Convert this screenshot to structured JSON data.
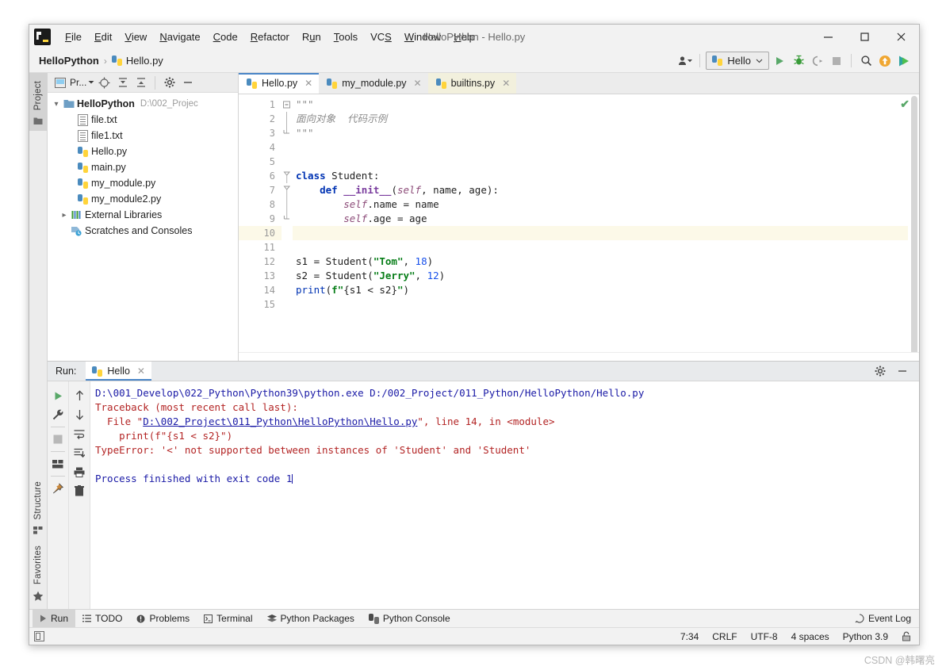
{
  "window": {
    "title": "HelloPython - Hello.py",
    "app_icon": "pycharm-logo-icon",
    "minimize": "—",
    "maximize": "□",
    "close": "✕"
  },
  "menu": {
    "items": [
      {
        "label": "File",
        "mnemonic": "F"
      },
      {
        "label": "Edit",
        "mnemonic": "E"
      },
      {
        "label": "View",
        "mnemonic": "V"
      },
      {
        "label": "Navigate",
        "mnemonic": "N"
      },
      {
        "label": "Code",
        "mnemonic": "C"
      },
      {
        "label": "Refactor",
        "mnemonic": "R"
      },
      {
        "label": "Run",
        "mnemonic": "u"
      },
      {
        "label": "Tools",
        "mnemonic": "T"
      },
      {
        "label": "VCS",
        "mnemonic": "S"
      },
      {
        "label": "Window",
        "mnemonic": "W"
      },
      {
        "label": "Help",
        "mnemonic": "H"
      }
    ]
  },
  "navbar": {
    "project_name": "HelloPython",
    "separator": "›",
    "file_name": "Hello.py",
    "run_config": "Hello",
    "buttons": [
      "user-icon",
      "run-button",
      "debug-button",
      "coverage-button",
      "stop-button",
      "search-everywhere-icon",
      "update-project-icon",
      "ide-assistant-icon"
    ]
  },
  "left_rail": {
    "top_label": "Project",
    "bottom_labels": [
      "Structure",
      "Favorites"
    ]
  },
  "project_panel": {
    "toolbar_label": "Pr...",
    "toolbar_icons": [
      "project-view-icon",
      "locate-icon",
      "expand-all-icon",
      "collapse-all-icon",
      "settings-icon",
      "hide-icon"
    ],
    "tree": [
      {
        "label": "HelloPython",
        "path": "D:\\002_Projec",
        "icon": "folder-icon",
        "arrow": "v",
        "indent": 0,
        "bold": true
      },
      {
        "label": "file.txt",
        "icon": "text-file-icon",
        "arrow": "",
        "indent": 1,
        "bold": false
      },
      {
        "label": "file1.txt",
        "icon": "text-file-icon",
        "arrow": "",
        "indent": 1,
        "bold": false
      },
      {
        "label": "Hello.py",
        "icon": "python-file-icon",
        "arrow": "",
        "indent": 1,
        "bold": false
      },
      {
        "label": "main.py",
        "icon": "python-file-icon",
        "arrow": "",
        "indent": 1,
        "bold": false
      },
      {
        "label": "my_module.py",
        "icon": "python-file-icon",
        "arrow": "",
        "indent": 1,
        "bold": false
      },
      {
        "label": "my_module2.py",
        "icon": "python-file-icon",
        "arrow": "",
        "indent": 1,
        "bold": false
      },
      {
        "label": "External Libraries",
        "icon": "libraries-icon",
        "arrow": ">",
        "indent": 0,
        "bold": false
      },
      {
        "label": "Scratches and Consoles",
        "icon": "scratches-icon",
        "arrow": "",
        "indent": 0,
        "bold": false
      }
    ]
  },
  "editor": {
    "tabs": [
      {
        "label": "Hello.py",
        "icon": "python-file-icon",
        "state": "active"
      },
      {
        "label": "my_module.py",
        "icon": "python-file-icon",
        "state": "normal"
      },
      {
        "label": "builtins.py",
        "icon": "python-file-icon",
        "state": "highlight"
      }
    ],
    "inspection_status": "ok-check-icon",
    "current_line": 10,
    "line_numbers": [
      1,
      2,
      3,
      4,
      5,
      6,
      7,
      8,
      9,
      10,
      11,
      12,
      13,
      14,
      15
    ],
    "lines": [
      "\"\"\"",
      "面向对象  代码示例",
      "\"\"\"",
      "",
      "",
      "class Student:",
      "    def __init__(self, name, age):",
      "        self.name = name",
      "        self.age = age",
      "",
      "",
      "s1 = Student(\"Tom\", 18)",
      "s2 = Student(\"Jerry\", 12)",
      "print(f\"{s1 < s2}\")",
      ""
    ]
  },
  "run_panel": {
    "label": "Run:",
    "tab": "Hello",
    "tab_icon": "python-file-icon",
    "header_icons": [
      "settings-gear-icon",
      "hide-icon"
    ],
    "left_icons": [
      "rerun-button",
      "wrench-icon",
      "stop-button",
      "layout-icon",
      "pin-icon"
    ],
    "right_icons": [
      "scroll-up-icon",
      "scroll-down-icon",
      "soft-wrap-icon",
      "scroll-to-end-icon",
      "print-icon",
      "clear-all-icon"
    ],
    "output": [
      {
        "text": "D:\\001_Develop\\022_Python\\Python39\\python.exe D:/002_Project/011_Python/HelloPython/Hello.py",
        "style": "blue"
      },
      {
        "text": "Traceback (most recent call last):",
        "style": "red"
      },
      {
        "text": "  File \"D:\\002_Project\\011_Python\\HelloPython\\Hello.py\", line 14, in <module>",
        "style": "red-with-link"
      },
      {
        "text": "    print(f\"{s1 < s2}\")",
        "style": "red"
      },
      {
        "text": "TypeError: '<' not supported between instances of 'Student' and 'Student'",
        "style": "red"
      },
      {
        "text": "",
        "style": "blue"
      },
      {
        "text": "Process finished with exit code 1",
        "style": "blue-caret"
      }
    ],
    "link_text": "D:\\002_Project\\011_Python\\HelloPython\\Hello.py"
  },
  "bottom_bar": {
    "tools": [
      {
        "label": "Run",
        "icon": "run-triangle-icon",
        "active": true
      },
      {
        "label": "TODO",
        "icon": "todo-icon",
        "active": false
      },
      {
        "label": "Problems",
        "icon": "problems-icon",
        "active": false
      },
      {
        "label": "Terminal",
        "icon": "terminal-icon",
        "active": false
      },
      {
        "label": "Python Packages",
        "icon": "packages-icon",
        "active": false
      },
      {
        "label": "Python Console",
        "icon": "python-console-icon",
        "active": false
      }
    ],
    "event_log": "Event Log",
    "event_log_icon": "event-log-icon"
  },
  "status_bar": {
    "caret_position": "7:34",
    "line_separator": "CRLF",
    "encoding": "UTF-8",
    "indent": "4 spaces",
    "interpreter": "Python 3.9",
    "lock_icon": "lock-icon",
    "left_icon": "show-tool-windows-icon"
  },
  "watermark": "CSDN @韩曙亮",
  "colors": {
    "accent_blue": "#4a86c7",
    "keyword": "#0033b3",
    "string": "#067d17",
    "number": "#1750eb",
    "error_red": "#b32424",
    "console_blue": "#1a1aa6",
    "ok_green": "#59a869"
  }
}
